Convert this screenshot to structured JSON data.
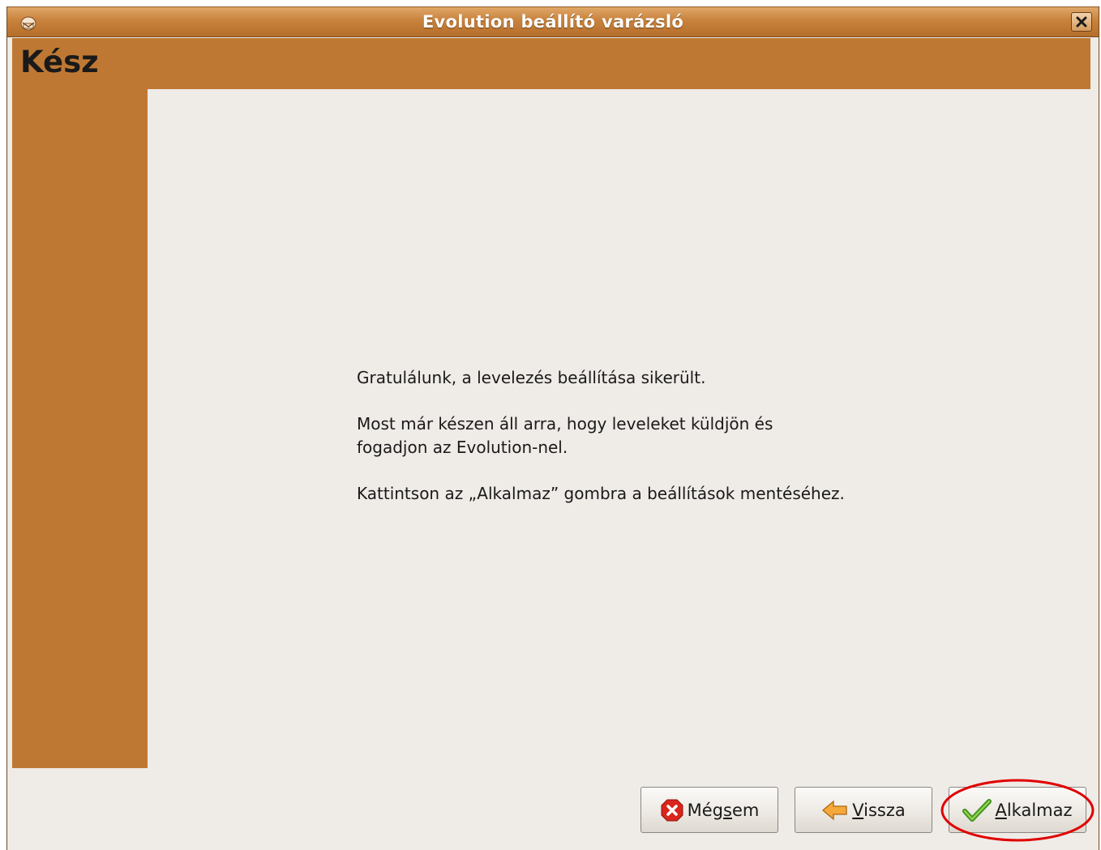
{
  "window": {
    "title": "Evolution beállító varázsló"
  },
  "page": {
    "heading": "Kész",
    "messages": [
      "Gratulálunk, a levelezés beállítása sikerült.",
      "Most már készen áll arra, hogy leveleket küldjön és\nfogadjon az Evolution-nel.",
      "Kattintson az „Alkalmaz” gombra a beállítások mentéséhez."
    ]
  },
  "buttons": {
    "cancel": {
      "before": "Még",
      "mnemonic": "s",
      "after": "em",
      "icon": "cancel-icon"
    },
    "back": {
      "before": "",
      "mnemonic": "V",
      "after": "issza",
      "icon": "back-arrow-icon"
    },
    "apply": {
      "before": "",
      "mnemonic": "A",
      "after": "lkalmaz",
      "icon": "checkmark-icon"
    }
  },
  "colors": {
    "accent": "#bf7833",
    "background": "#efebe7",
    "highlight_circle": "#e00000"
  }
}
